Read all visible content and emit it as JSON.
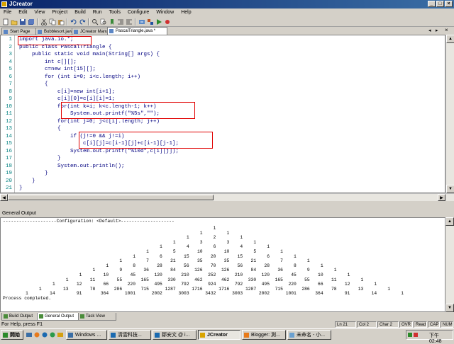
{
  "window": {
    "title": "JCreator"
  },
  "menu": [
    "File",
    "Edit",
    "View",
    "Project",
    "Build",
    "Run",
    "Tools",
    "Configure",
    "Window",
    "Help"
  ],
  "tabs": [
    {
      "label": "Start Page",
      "active": false
    },
    {
      "label": "Bubblesort.java",
      "active": false
    },
    {
      "label": "JCreator Manual",
      "active": false
    },
    {
      "label": "PascalTriangle.java *",
      "active": true
    }
  ],
  "editor": {
    "lines": [
      {
        "n": "1",
        "text": "import java.io.*;"
      },
      {
        "n": "2",
        "text": "public class PascalTriangle {"
      },
      {
        "n": "3",
        "text": "    public static void main(String[] args) {"
      },
      {
        "n": "4",
        "text": "        int c[][];"
      },
      {
        "n": "5",
        "text": "        c=new int[15][];"
      },
      {
        "n": "6",
        "text": "        for (int i=0; i<c.length; i++)"
      },
      {
        "n": "7",
        "text": "        {"
      },
      {
        "n": "8",
        "text": "            c[i]=new int[i+1];"
      },
      {
        "n": "9",
        "text": "            c[i][0]=c[i][i]=1;"
      },
      {
        "n": "10",
        "text": "            for(int k=i; k<c.length-1; k++)"
      },
      {
        "n": "11",
        "text": "                System.out.printf(\"%5s\",\"\");"
      },
      {
        "n": "12",
        "text": "            for(int j=0; j<c[i].length; j++)"
      },
      {
        "n": "13",
        "text": "            {"
      },
      {
        "n": "14",
        "text": "                if (j!=0 && j!=i)"
      },
      {
        "n": "15",
        "text": "                    c[i][j]=c[i-1][j]+c[i-1][j-1];"
      },
      {
        "n": "16",
        "text": "                System.out.printf(\"%10d\",c[i][j]);"
      },
      {
        "n": "17",
        "text": "            }"
      },
      {
        "n": "18",
        "text": "            System.out.println();"
      },
      {
        "n": "19",
        "text": "        }"
      },
      {
        "n": "20",
        "text": "    }"
      },
      {
        "n": "21",
        "text": "}"
      }
    ]
  },
  "output": {
    "title": "General Output",
    "config_line": "--------------------Configuration: <Default>--------------------",
    "process_line": "Process completed.",
    "triangle_rows": [
      [
        "1"
      ],
      [
        "1",
        "1"
      ],
      [
        "1",
        "2",
        "1"
      ],
      [
        "1",
        "3",
        "3",
        "1"
      ],
      [
        "1",
        "4",
        "6",
        "4",
        "1"
      ],
      [
        "1",
        "5",
        "10",
        "10",
        "5",
        "1"
      ],
      [
        "1",
        "6",
        "15",
        "20",
        "15",
        "6",
        "1"
      ],
      [
        "1",
        "7",
        "21",
        "35",
        "35",
        "21",
        "7",
        "1"
      ],
      [
        "1",
        "8",
        "28",
        "56",
        "70",
        "56",
        "28",
        "8",
        "1"
      ],
      [
        "1",
        "9",
        "36",
        "84",
        "126",
        "126",
        "84",
        "36",
        "9",
        "1"
      ],
      [
        "1",
        "10",
        "45",
        "120",
        "210",
        "252",
        "210",
        "120",
        "45",
        "10",
        "1"
      ],
      [
        "1",
        "11",
        "55",
        "165",
        "330",
        "462",
        "462",
        "330",
        "165",
        "55",
        "11",
        "1"
      ],
      [
        "1",
        "12",
        "66",
        "220",
        "495",
        "792",
        "924",
        "792",
        "495",
        "220",
        "66",
        "12",
        "1"
      ],
      [
        "1",
        "13",
        "78",
        "286",
        "715",
        "1287",
        "1716",
        "1716",
        "1287",
        "715",
        "286",
        "78",
        "13",
        "1"
      ],
      [
        "1",
        "14",
        "91",
        "364",
        "1001",
        "2002",
        "3003",
        "3432",
        "3003",
        "2002",
        "1001",
        "364",
        "91",
        "14",
        "1"
      ]
    ],
    "tabs": [
      {
        "label": "Build Output",
        "active": false
      },
      {
        "label": "General Output",
        "active": true
      },
      {
        "label": "Task View",
        "active": false
      }
    ]
  },
  "status": {
    "hint": "For Help, press F1",
    "line": "Ln 21",
    "col": "Col 2",
    "char": "Char 2",
    "ovr": "OVR",
    "read": "Read",
    "cap": "CAP",
    "num": "NUM"
  },
  "taskbar": {
    "start": "開始",
    "tasks": [
      {
        "label": "Windows ...",
        "active": false
      },
      {
        "label": "清雲科技...",
        "active": false
      },
      {
        "label": "鄒安文 @ i...",
        "active": false
      },
      {
        "label": "JCreator",
        "active": true
      },
      {
        "label": "Blogger: 測...",
        "active": false
      },
      {
        "label": "未命名 - 小...",
        "active": false
      }
    ],
    "clock": "下午 02:48"
  }
}
